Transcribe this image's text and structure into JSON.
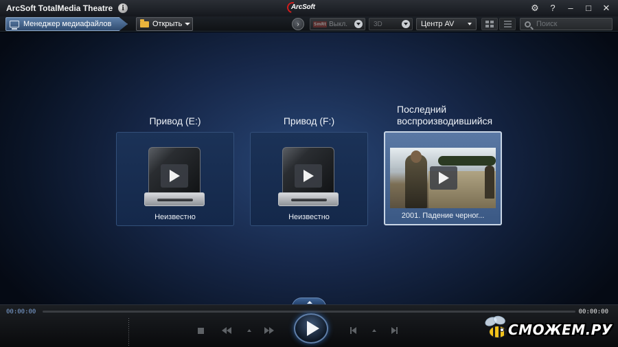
{
  "titlebar": {
    "app_title": "ArcSoft TotalMedia Theatre",
    "brand_logo": "ArcSoft",
    "info_glyph": "i",
    "settings_glyph": "⚙",
    "help_glyph": "?",
    "minimize_glyph": "–",
    "maximize_glyph": "□",
    "close_glyph": "✕"
  },
  "toolbar": {
    "media_manager_label": "Менеджер медиафайлов",
    "open_label": "Открыть",
    "smart_badge": "SmRt",
    "smart_value": "Выкл.",
    "threed_value": "3D",
    "audio_mode_value": "Центр AV",
    "search_placeholder": "Поиск",
    "next_glyph": "›"
  },
  "cards": [
    {
      "title": "Привод (E:)",
      "label": "Неизвестно",
      "icon": "drive-icon"
    },
    {
      "title": "Привод (F:)",
      "label": "Неизвестно",
      "icon": "drive-icon"
    },
    {
      "title": "Последний воспроизводившийся",
      "label": "2001. Падение черног...",
      "icon": "video-thumbnail",
      "selected": true
    }
  ],
  "player": {
    "time_elapsed": "00:00:00",
    "time_total": "00:00:00"
  },
  "watermark": {
    "text": "СМОЖЕМ.РУ"
  },
  "colors": {
    "accent_blue": "#5d7fa8",
    "background_blue": "#284676",
    "time_elapsed": "#7fa3d6"
  }
}
